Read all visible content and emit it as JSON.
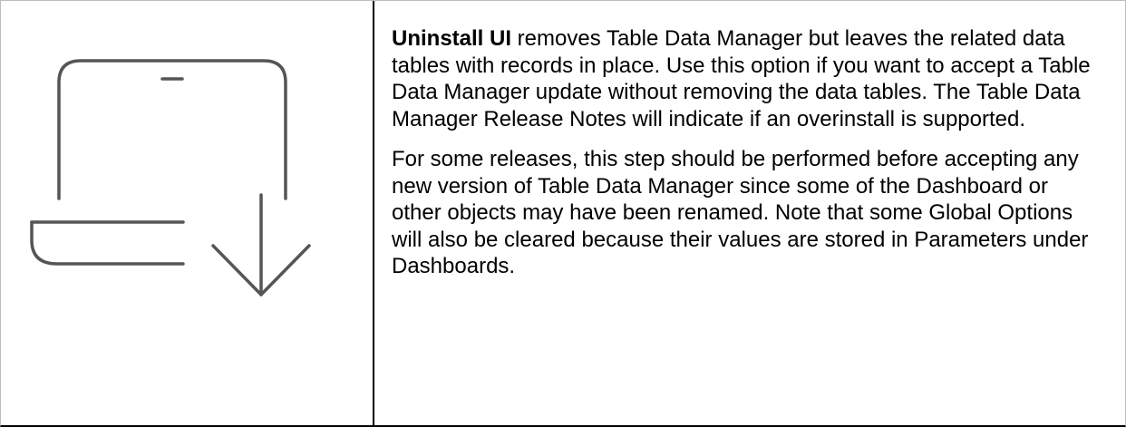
{
  "icon": {
    "name": "laptop-download-icon",
    "stroke_color": "#555555"
  },
  "description": {
    "paragraph_1": {
      "lead": "Uninstall UI",
      "text": " removes Table Data Manager but leaves the related data tables with records in place. Use this option if you want to accept a Table Data Manager update without removing the data tables. The Table Data Manager Release Notes will indicate if an overinstall is supported."
    },
    "paragraph_2": {
      "text": "For some releases, this step should be performed before accepting any new version of Table Data Manager since some of the Dashboard or other objects may have been renamed. Note that some Global Options will also be cleared because their values are stored in Parameters under Dashboards."
    }
  }
}
